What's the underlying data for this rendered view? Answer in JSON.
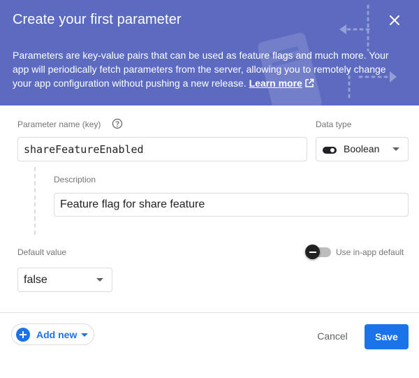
{
  "dialog": {
    "title": "Create your first parameter",
    "close_icon": "close-icon",
    "description": "Parameters are key-value pairs that can be used as feature flags and much more. Your app will periodically fetch parameters from the server, allowing you to remotely change your app configuration without pushing a new release.",
    "learn_more": "Learn more"
  },
  "form": {
    "param_name_label": "Parameter name (key)",
    "param_name_value": "shareFeatureEnabled",
    "data_type_label": "Data type",
    "data_type_value": "Boolean",
    "description_label": "Description",
    "description_value": "Feature flag for share feature",
    "default_value_label": "Default value",
    "default_value": "false",
    "in_app_default_label": "Use in-app default",
    "in_app_default_on": false
  },
  "footer": {
    "add_new": "Add new",
    "cancel": "Cancel",
    "save": "Save"
  },
  "colors": {
    "header": "#5c6bc0",
    "accent": "#1a73e8"
  }
}
